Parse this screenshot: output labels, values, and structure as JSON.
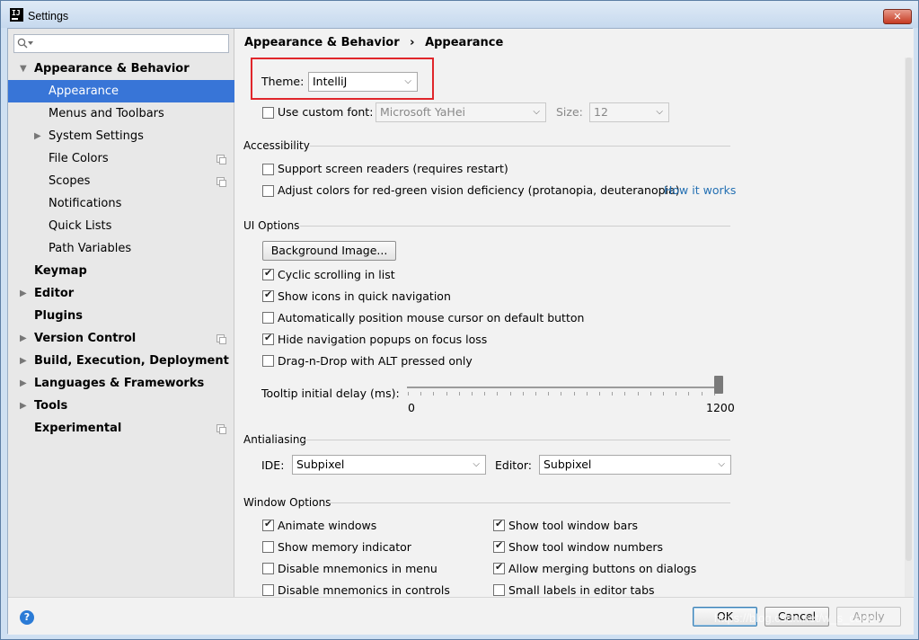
{
  "window": {
    "title": "Settings",
    "close_label": "✕"
  },
  "search": {
    "placeholder": ""
  },
  "sidebar": {
    "items": [
      {
        "label": "Appearance & Behavior"
      },
      {
        "label": "Appearance"
      },
      {
        "label": "Menus and Toolbars"
      },
      {
        "label": "System Settings"
      },
      {
        "label": "File Colors"
      },
      {
        "label": "Scopes"
      },
      {
        "label": "Notifications"
      },
      {
        "label": "Quick Lists"
      },
      {
        "label": "Path Variables"
      },
      {
        "label": "Keymap"
      },
      {
        "label": "Editor"
      },
      {
        "label": "Plugins"
      },
      {
        "label": "Version Control"
      },
      {
        "label": "Build, Execution, Deployment"
      },
      {
        "label": "Languages & Frameworks"
      },
      {
        "label": "Tools"
      },
      {
        "label": "Experimental"
      }
    ]
  },
  "breadcrumb": {
    "parent": "Appearance & Behavior",
    "separator": "›",
    "current": "Appearance"
  },
  "theme": {
    "label": "Theme:",
    "value": "IntelliJ"
  },
  "custom_font": {
    "label": "Use custom font:",
    "checked": false,
    "font_value": "Microsoft YaHei",
    "size_label": "Size:",
    "size_value": "12"
  },
  "accessibility": {
    "title": "Accessibility",
    "screen_readers": "Support screen readers (requires restart)",
    "adjust_colors": "Adjust colors for red-green vision deficiency (protanopia, deuteranopia)",
    "how_it_works": "How it works"
  },
  "ui_options": {
    "title": "UI Options",
    "background_image_button": "Background Image...",
    "options": [
      {
        "label": "Cyclic scrolling in list",
        "checked": true
      },
      {
        "label": "Show icons in quick navigation",
        "checked": true
      },
      {
        "label": "Automatically position mouse cursor on default button",
        "checked": false
      },
      {
        "label": "Hide navigation popups on focus loss",
        "checked": true
      },
      {
        "label": "Drag-n-Drop with ALT pressed only",
        "checked": false
      }
    ],
    "tooltip_label": "Tooltip initial delay (ms):",
    "tooltip_min": "0",
    "tooltip_max": "1200",
    "tooltip_value": 1200
  },
  "antialiasing": {
    "title": "Antialiasing",
    "ide_label": "IDE:",
    "ide_value": "Subpixel",
    "editor_label": "Editor:",
    "editor_value": "Subpixel"
  },
  "window_options": {
    "title": "Window Options",
    "left": [
      {
        "label": "Animate windows",
        "checked": true
      },
      {
        "label": "Show memory indicator",
        "checked": false
      },
      {
        "label": "Disable mnemonics in menu",
        "checked": false
      },
      {
        "label": "Disable mnemonics in controls",
        "checked": false
      }
    ],
    "right": [
      {
        "label": "Show tool window bars",
        "checked": true
      },
      {
        "label": "Show tool window numbers",
        "checked": true
      },
      {
        "label": "Allow merging buttons on dialogs",
        "checked": true
      },
      {
        "label": "Small labels in editor tabs",
        "checked": false
      }
    ]
  },
  "footer": {
    "help": "?",
    "ok": "OK",
    "cancel": "Cancel",
    "apply": "Apply"
  },
  "watermark": "https://blog.csdn.net/w_s_code"
}
